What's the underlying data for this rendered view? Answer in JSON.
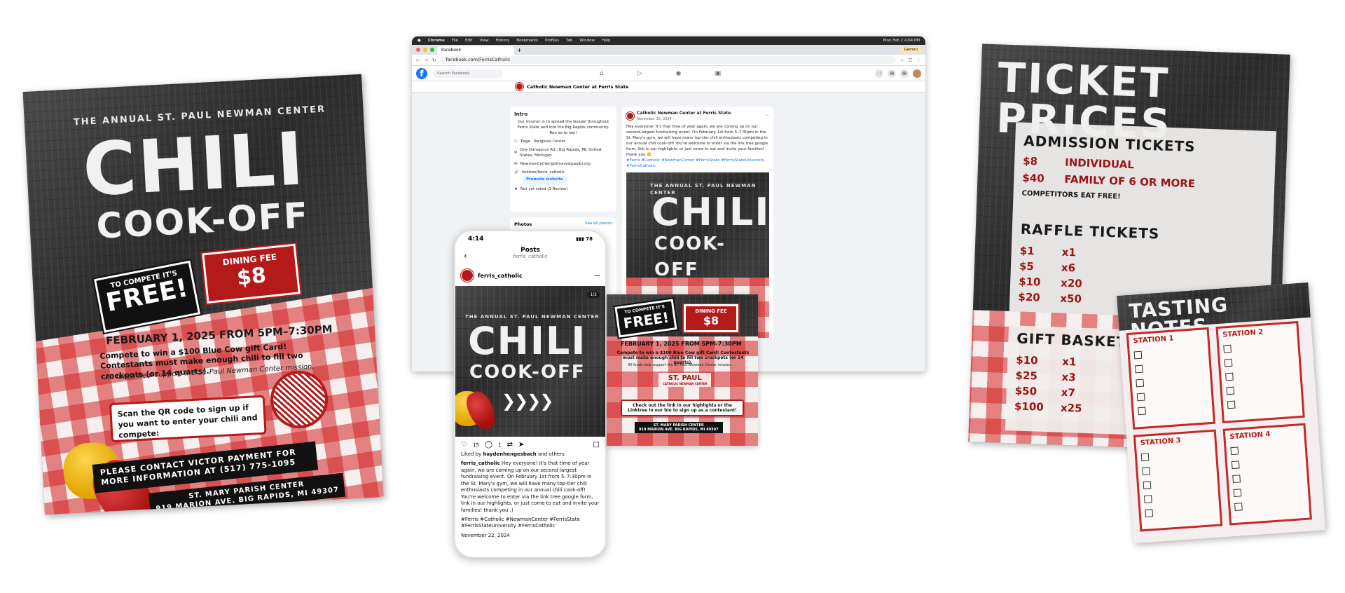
{
  "flyer": {
    "annual": "THE ANNUAL ST. PAUL NEWMAN CENTER",
    "title1": "CHILI",
    "title2": "COOK-OFF",
    "compete_small": "TO COMPETE IT'S",
    "compete_big": "FREE!",
    "fee_small": "DINING FEE",
    "fee_big": "$8",
    "date": "FEBRUARY 1, 2025 FROM 5PM–7:30PM",
    "compete_text": "Compete to win a $100 Blue Cow gift Card! Contestants must make enough chili to fill two crockpots (or 14 quarts).",
    "funds": "All funds help support the St. Paul Newman Center mission.",
    "scan": "Scan the QR code to sign up if you want to enter your chili and compete:",
    "contact": "PLEASE CONTACT VICTOR PAYMENT FOR MORE INFORMATION AT (517) 775-1095",
    "venue1": "ST. MARY PARISH CENTER",
    "venue2": "919 MARION AVE. BIG RAPIDS, MI 49307"
  },
  "browser": {
    "macbar": {
      "app": "Chrome",
      "menus": [
        "File",
        "Edit",
        "View",
        "History",
        "Bookmarks",
        "Profiles",
        "Tab",
        "Window",
        "Help"
      ],
      "clock": "Mon Feb 2  4:04 PM"
    },
    "tab_title": "Facebook",
    "gemini": "Gemini",
    "url": "facebook.com/FerrisCatholic",
    "search_placeholder": "Search Facebook",
    "page_name": "Catholic Newman Center at Ferris State",
    "intro": {
      "heading": "Intro",
      "mission": "Our mission is to spread the Gospel throughout Ferris State and into the Big Rapids community. Run as to win!",
      "category": "Page · Religious Center",
      "address": "One Damascus Rd., Big Rapids, MI, United States, Michigan",
      "email": "NewmanCenter@stmarystpaulbr.org",
      "link": "linktree/ferris_catholic",
      "promote": "Promote website",
      "rating": "Not yet rated (1 Review)"
    },
    "photos": {
      "heading": "Photos",
      "see_all": "See all photos"
    },
    "post": {
      "author": "Catholic Newman Center at Ferris State",
      "date": "November 30, 2024 · ",
      "body": "Hey everyone! It's that time of year again, we are coming up on our second-largest fundraising event. On February 1st from 5–7:30pm in the St. Mary's gym, we will have many top-tier chili enthusiasts competing in our annual chili cook-off! You're welcome to enter via the link tree google form, link in our highlights, or just come to eat and invite your families! thank you 🙂",
      "tags": "#Ferris #Catholic #NewmanCenter #FerrisState #FerrisStateUniversity #FerrisCatholic"
    }
  },
  "phone": {
    "time": "4:14",
    "battery": "78",
    "header": "Posts",
    "sub": "ferris_catholic",
    "username": "ferris_catholic",
    "counter": "1/2",
    "likes_count": "15",
    "comments_count": "1",
    "liked_by": "Liked by ",
    "liked_by_user": "haydenhengesbach",
    "liked_by_tail": " and others",
    "caption_user": "ferris_catholic",
    "caption": " Hey everyone! It's that time of year again, we are coming up on our second-largest fundraising event. On February 1st from 5–7:30pm in the St. Mary's gym, we will have many top-tier chili enthusiasts competing in our annual chili cook-off! You're welcome to enter via the link tree google form, link in our highlights, or just come to eat and invite your families! thank you :)",
    "tags": "#Ferris #Catholic #NewmanCenter #FerrisState #FerrisStateUniversity #FerrisCatholic",
    "date": "November 22, 2024"
  },
  "slide2": {
    "compete_small": "TO COMPETE IT'S",
    "compete_big": "FREE!",
    "fee_small": "DINING FEE",
    "fee_big": "$8",
    "date": "FEBRUARY 1, 2025 FROM 5PM–7:30PM",
    "compete_text": "Compete to win a $100 Blue Cow gift Card! Contestants must make enough chili to fill two crockpots (or 14 quarts).",
    "funds": "All funds help support the St. Paul Newman Center mission.",
    "logo_text": "ST. PAUL",
    "logo_sub": "CATHOLIC NEWMAN CENTER",
    "link_box": "Check out the link in our highlights or the Linktree in our bio to sign up as a contestant!",
    "venue1": "ST. MARY PARISH CENTER",
    "venue2": "919 MARION AVE. BIG RAPIDS, MI 49307"
  },
  "prices": {
    "title": "TICKET PRICES",
    "admission_heading": "ADMISSION TICKETS",
    "admission": [
      {
        "price": "$8",
        "label": "INDIVIDUAL"
      },
      {
        "price": "$40",
        "label": "FAMILY OF 6 OR MORE"
      }
    ],
    "competitors": "COMPETITORS EAT FREE!",
    "raffle_heading": "RAFFLE TICKETS",
    "raffle": [
      {
        "price": "$1",
        "qty": "x1"
      },
      {
        "price": "$5",
        "qty": "x6"
      },
      {
        "price": "$10",
        "qty": "x20"
      },
      {
        "price": "$20",
        "qty": "x50"
      }
    ],
    "basket_heading": "GIFT BASKET",
    "basket": [
      {
        "price": "$10",
        "qty": "x1"
      },
      {
        "price": "$25",
        "qty": "x3"
      },
      {
        "price": "$50",
        "qty": "x7"
      },
      {
        "price": "$100",
        "qty": "x25"
      }
    ]
  },
  "tasting": {
    "title": "TASTING NOTES",
    "stations": [
      "STATION 1",
      "STATION 2",
      "STATION 3",
      "STATION 4"
    ]
  }
}
